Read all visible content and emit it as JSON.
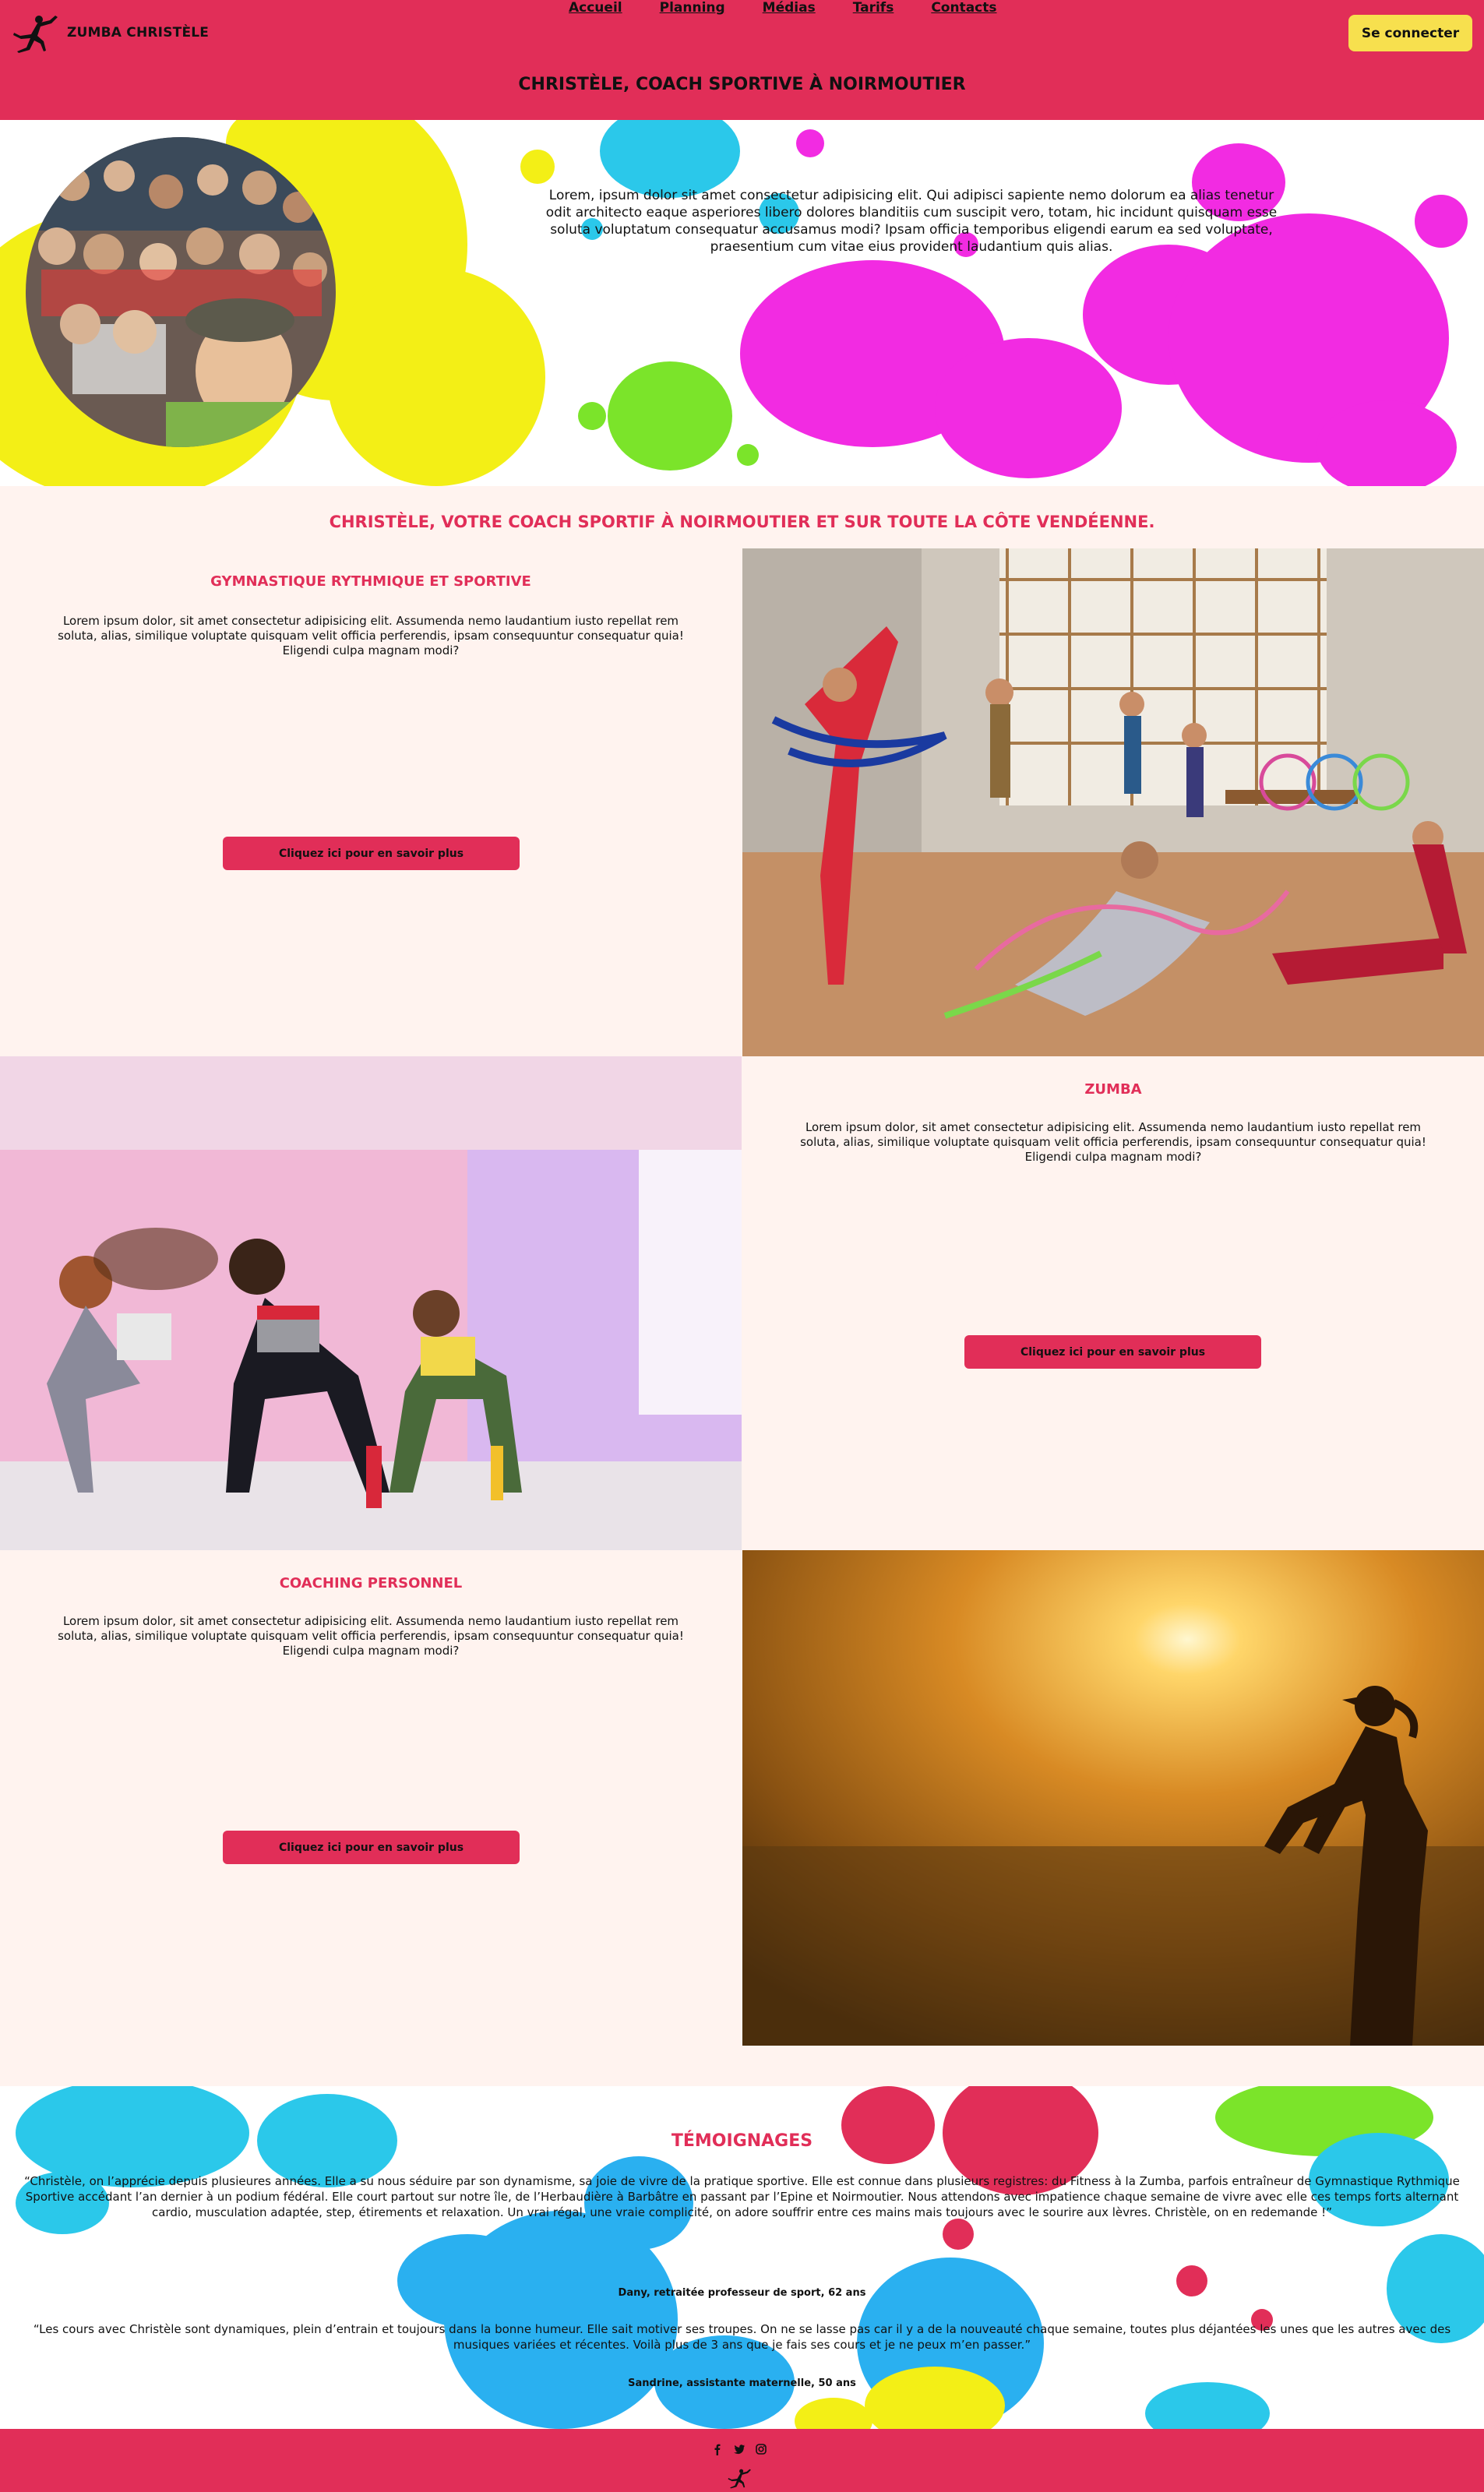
{
  "header": {
    "brand_name": "ZUMBA CHRISTÈLE",
    "nav": [
      "Accueil",
      "Planning",
      "Médias",
      "Tarifs",
      "Contacts"
    ],
    "login_label": "Se connecter",
    "title": "CHRISTÈLE, COACH SPORTIVE À NOIRMOUTIER"
  },
  "hero": {
    "text": "Lorem, ipsum dolor sit amet consectetur adipisicing elit. Qui adipisci sapiente nemo dolorum ea alias tenetur odit architecto eaque asperiores libero dolores blanditiis cum suscipit vero, totam, hic incidunt quisquam esse soluta voluptatum consequatur accusamus modi? Ipsam officia temporibus eligendi earum ea sed voluptate, praesentium cum vitae eius provident laudantium quis alias."
  },
  "services": {
    "title": "CHRISTÈLE, VOTRE COACH SPORTIF À NOIRMOUTIER ET SUR TOUTE LA CÔTE VENDÉENNE.",
    "items": [
      {
        "heading": "GYMNASTIQUE RYTHMIQUE ET SPORTIVE",
        "text": "Lorem ipsum dolor, sit amet consectetur adipisicing elit. Assumenda nemo laudantium iusto repellat rem soluta, alias, similique voluptate quisquam velit officia perferendis, ipsam consequuntur consequatur quia! Eligendi culpa magnam modi?",
        "button": "Cliquez ici pour en savoir plus"
      },
      {
        "heading": "ZUMBA",
        "text": "Lorem ipsum dolor, sit amet consectetur adipisicing elit. Assumenda nemo laudantium iusto repellat rem soluta, alias, similique voluptate quisquam velit officia perferendis, ipsam consequuntur consequatur quia! Eligendi culpa magnam modi?",
        "button": "Cliquez ici pour en savoir plus"
      },
      {
        "heading": "COACHING PERSONNEL",
        "text": "Lorem ipsum dolor, sit amet consectetur adipisicing elit. Assumenda nemo laudantium iusto repellat rem soluta, alias, similique voluptate quisquam velit officia perferendis, ipsam consequuntur consequatur quia! Eligendi culpa magnam modi?",
        "button": "Cliquez ici pour en savoir plus"
      }
    ]
  },
  "testimonials": {
    "title": "TÉMOIGNAGES",
    "items": [
      {
        "quote": "“Christèle, on l’apprécie depuis plusieures années. Elle a su nous séduire par son dynamisme, sa joie de vivre de la pratique sportive. Elle est connue dans plusieurs registres: du Fitness à la Zumba, parfois entraîneur de Gymnastique Rythmique Sportive accédant l’an dernier à un podium fédéral. Elle court partout sur notre île, de l’Herbaudière à Barbâtre en passant par l’Epine et Noirmoutier. Nous attendons avec impatience chaque semaine de vivre avec elle ces temps forts alternant cardio, musculation adaptée, step, étirements et relaxation. Un vrai régal, une vraie complicité, on adore souffrir entre ces mains mais toujours avec le sourire aux lèvres. Christèle, on en redemande !”",
        "author": "Dany, retraitée professeur de sport, 62 ans"
      },
      {
        "quote": "“Les cours avec Christèle sont dynamiques, plein d’entrain et toujours dans la bonne humeur. Elle sait motiver ses troupes. On ne se lasse pas car il y a de la nouveauté chaque semaine, toutes plus déjantées les unes que les autres avec des musiques variées et récentes. Voilà plus de 3 ans que je fais ses cours et je ne peux m’en passer.”",
        "author": "Sandrine, assistante maternelle, 50 ans"
      }
    ]
  },
  "footer": {
    "social_icons": [
      "facebook-icon",
      "twitter-icon",
      "instagram-icon"
    ]
  },
  "colors": {
    "brand_pink": "#e12e58",
    "button_yellow": "#f7e04e",
    "section_bg": "#fff3ef",
    "splash_yellow": "#f3ef16",
    "splash_cyan": "#2bc8ea",
    "splash_magenta": "#f22be2",
    "splash_green": "#7be42a",
    "splash_blue": "#2ab0f0"
  }
}
